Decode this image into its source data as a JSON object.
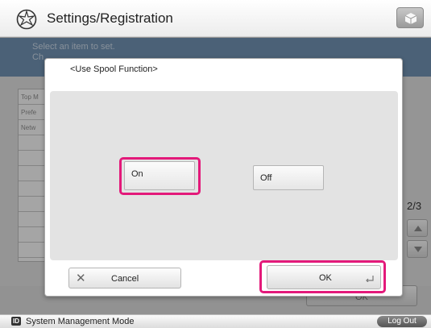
{
  "header": {
    "title": "Settings/Registration",
    "settings_icon": "settings-star-icon",
    "right_button_icon": "cube-icon"
  },
  "background": {
    "hint_lines": [
      "Select an item to set.",
      "Ch"
    ],
    "list_items": [
      "Top M",
      "Prefe",
      "Netw",
      "",
      "",
      "",
      "",
      "",
      "",
      "",
      ""
    ],
    "page_indicator": "2/3",
    "ok_label": "OK"
  },
  "dialog": {
    "title": "<Use Spool Function>",
    "options": {
      "on": "On",
      "off": "Off"
    },
    "cancel_label": "Cancel",
    "ok_label": "OK"
  },
  "bottom_bar": {
    "mode_icon": "ID",
    "mode_label": "System Management Mode",
    "logout_label": "Log Out"
  },
  "colors": {
    "highlight": "#e3197a",
    "header_blue": "#6f8fb0"
  }
}
